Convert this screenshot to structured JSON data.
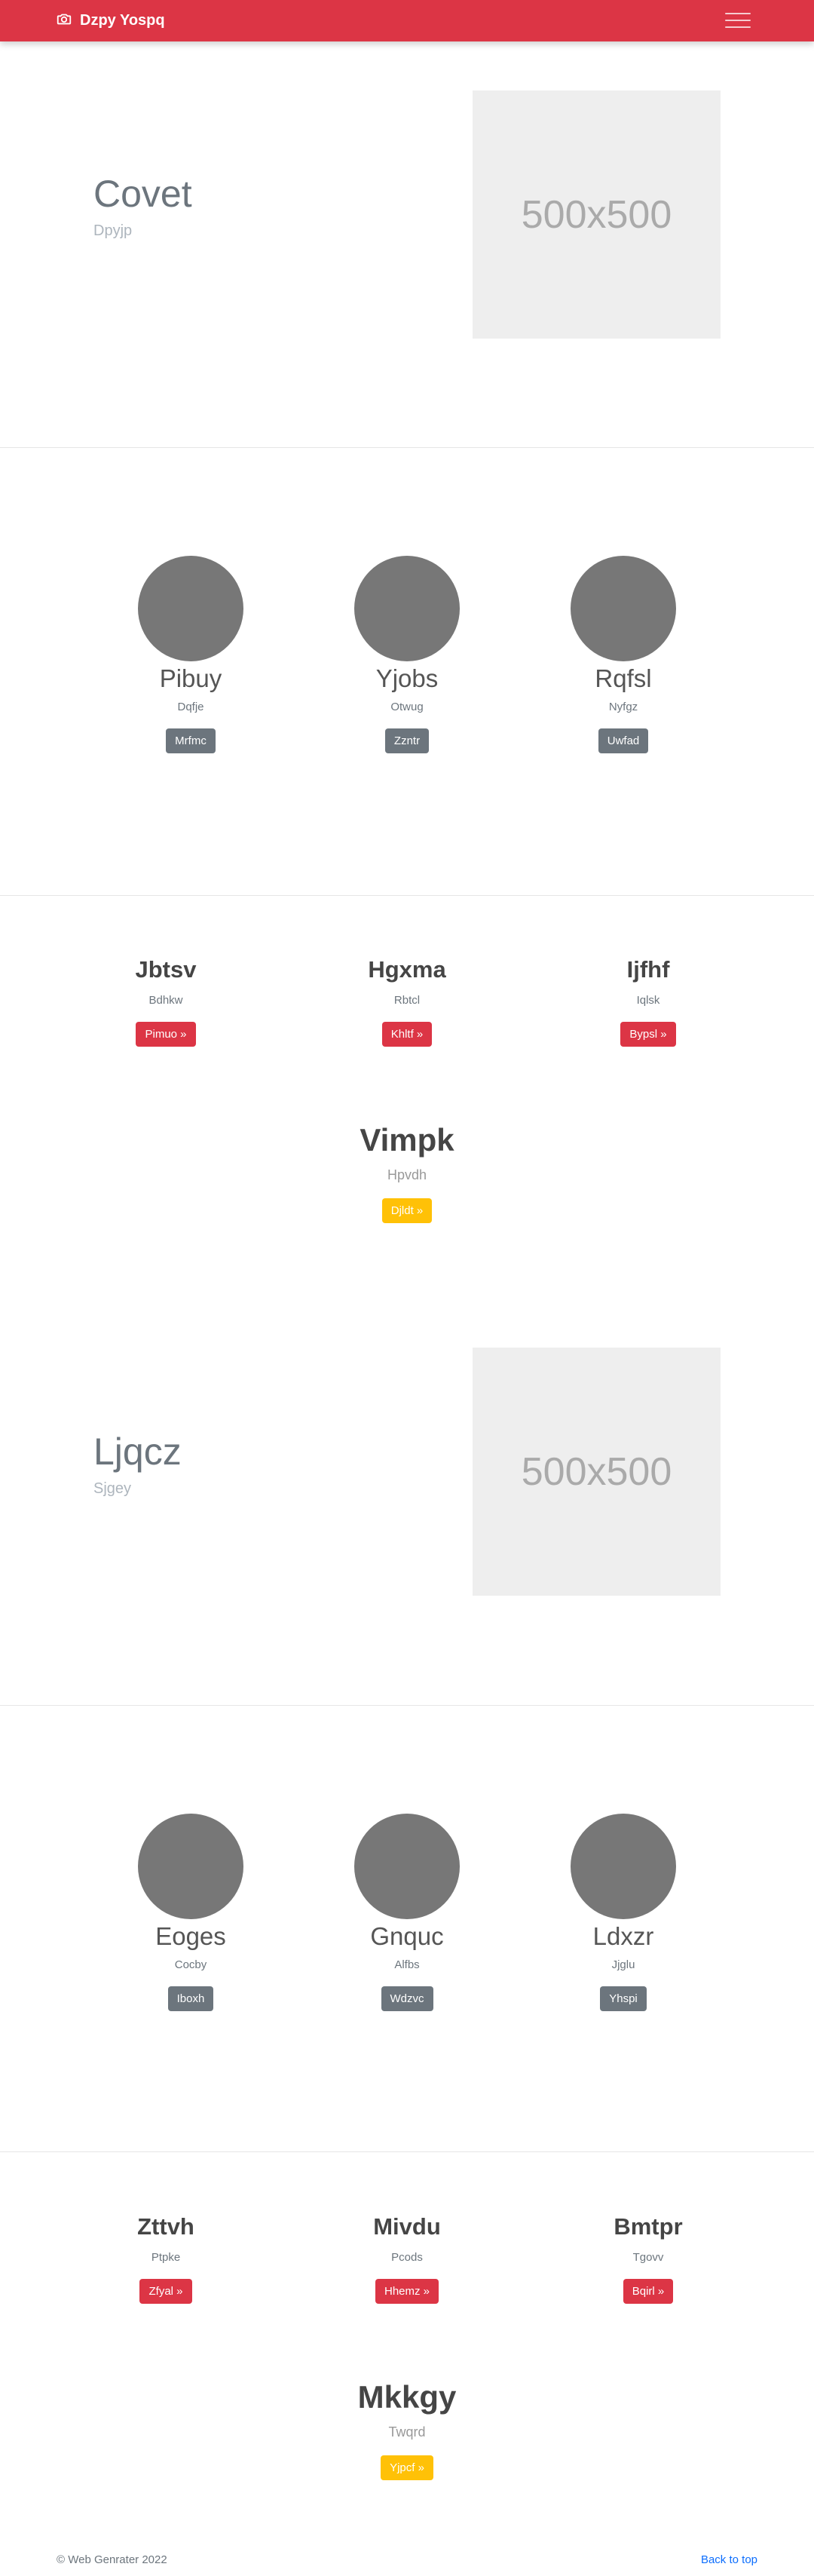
{
  "navbar": {
    "brand": "Dzpy Yospq",
    "brand_icon": "camera-icon",
    "menu_icon": "hamburger-icon"
  },
  "hero1": {
    "title": "Covet",
    "subtitle": "Dpyjp",
    "placeholder": "500x500"
  },
  "team1": [
    {
      "name": "Pibuy",
      "sub": "Dqfje",
      "button": "Mrfmc"
    },
    {
      "name": "Yjobs",
      "sub": "Otwug",
      "button": "Zzntr"
    },
    {
      "name": "Rqfsl",
      "sub": "Nyfgz",
      "button": "Uwfad"
    }
  ],
  "features1": [
    {
      "title": "Jbtsv",
      "sub": "Bdhkw",
      "button": "Pimuo »"
    },
    {
      "title": "Hgxma",
      "sub": "Rbtcl",
      "button": "Khltf »"
    },
    {
      "title": "Ijfhf",
      "sub": "Iqlsk",
      "button": "Bypsl »"
    }
  ],
  "cta1": {
    "title": "Vimpk",
    "subtitle": "Hpvdh",
    "button": "Djldt »"
  },
  "hero2": {
    "title": "Ljqcz",
    "subtitle": "Sjgey",
    "placeholder": "500x500"
  },
  "team2": [
    {
      "name": "Eoges",
      "sub": "Cocby",
      "button": "Iboxh"
    },
    {
      "name": "Gnquc",
      "sub": "Alfbs",
      "button": "Wdzvc"
    },
    {
      "name": "Ldxzr",
      "sub": "Jjglu",
      "button": "Yhspi"
    }
  ],
  "features2": [
    {
      "title": "Zttvh",
      "sub": "Ptpke",
      "button": "Zfyal »"
    },
    {
      "title": "Mivdu",
      "sub": "Pcods",
      "button": "Hhemz »"
    },
    {
      "title": "Bmtpr",
      "sub": "Tgovv",
      "button": "Bqirl »"
    }
  ],
  "cta2": {
    "title": "Mkkgy",
    "subtitle": "Twqrd",
    "button": "Yjpcf »"
  },
  "footer": {
    "copyright": "© Web Genrater 2022",
    "back_to_top": "Back to top"
  },
  "colors": {
    "primary": "#dc3545",
    "secondary": "#6c757d",
    "warning": "#ffc107",
    "link": "#0d6efd"
  }
}
